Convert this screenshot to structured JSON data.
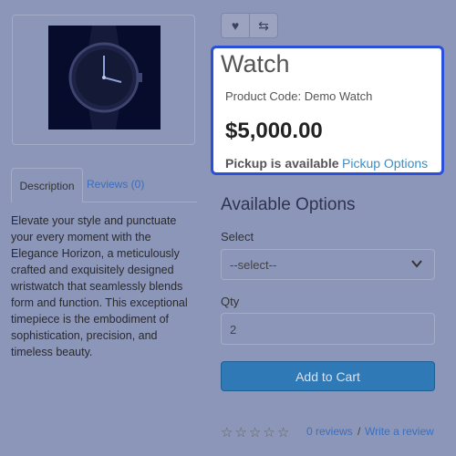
{
  "product": {
    "title": "Watch",
    "code_label": "Product Code: Demo Watch",
    "price": "$5,000.00",
    "pickup_text": "Pickup is available",
    "pickup_link": "Pickup Options"
  },
  "actions": {
    "wishlist_icon": "heart-icon",
    "compare_icon": "compare-icon"
  },
  "tabs": [
    {
      "label": "Description",
      "active": true
    },
    {
      "label": "Reviews (0)",
      "active": false
    }
  ],
  "description": "Elevate your style and punctuate your every moment with the Elegance Horizon, a meticulously crafted and exquisitely designed wristwatch that seamlessly blends form and function. This exceptional timepiece is the embodiment of sophistication, precision, and timeless beauty.",
  "options": {
    "heading": "Available Options",
    "select_label": "Select",
    "select_value": "--select--",
    "qty_label": "Qty",
    "qty_value": "2",
    "cart_label": "Add to Cart"
  },
  "rating": {
    "stars": 0,
    "reviews_link": "0 reviews",
    "separator": "/",
    "write_link": "Write a review"
  },
  "colors": {
    "highlight": "#2b4fd8",
    "link": "#3a8fc9",
    "button": "#2f79b6"
  }
}
